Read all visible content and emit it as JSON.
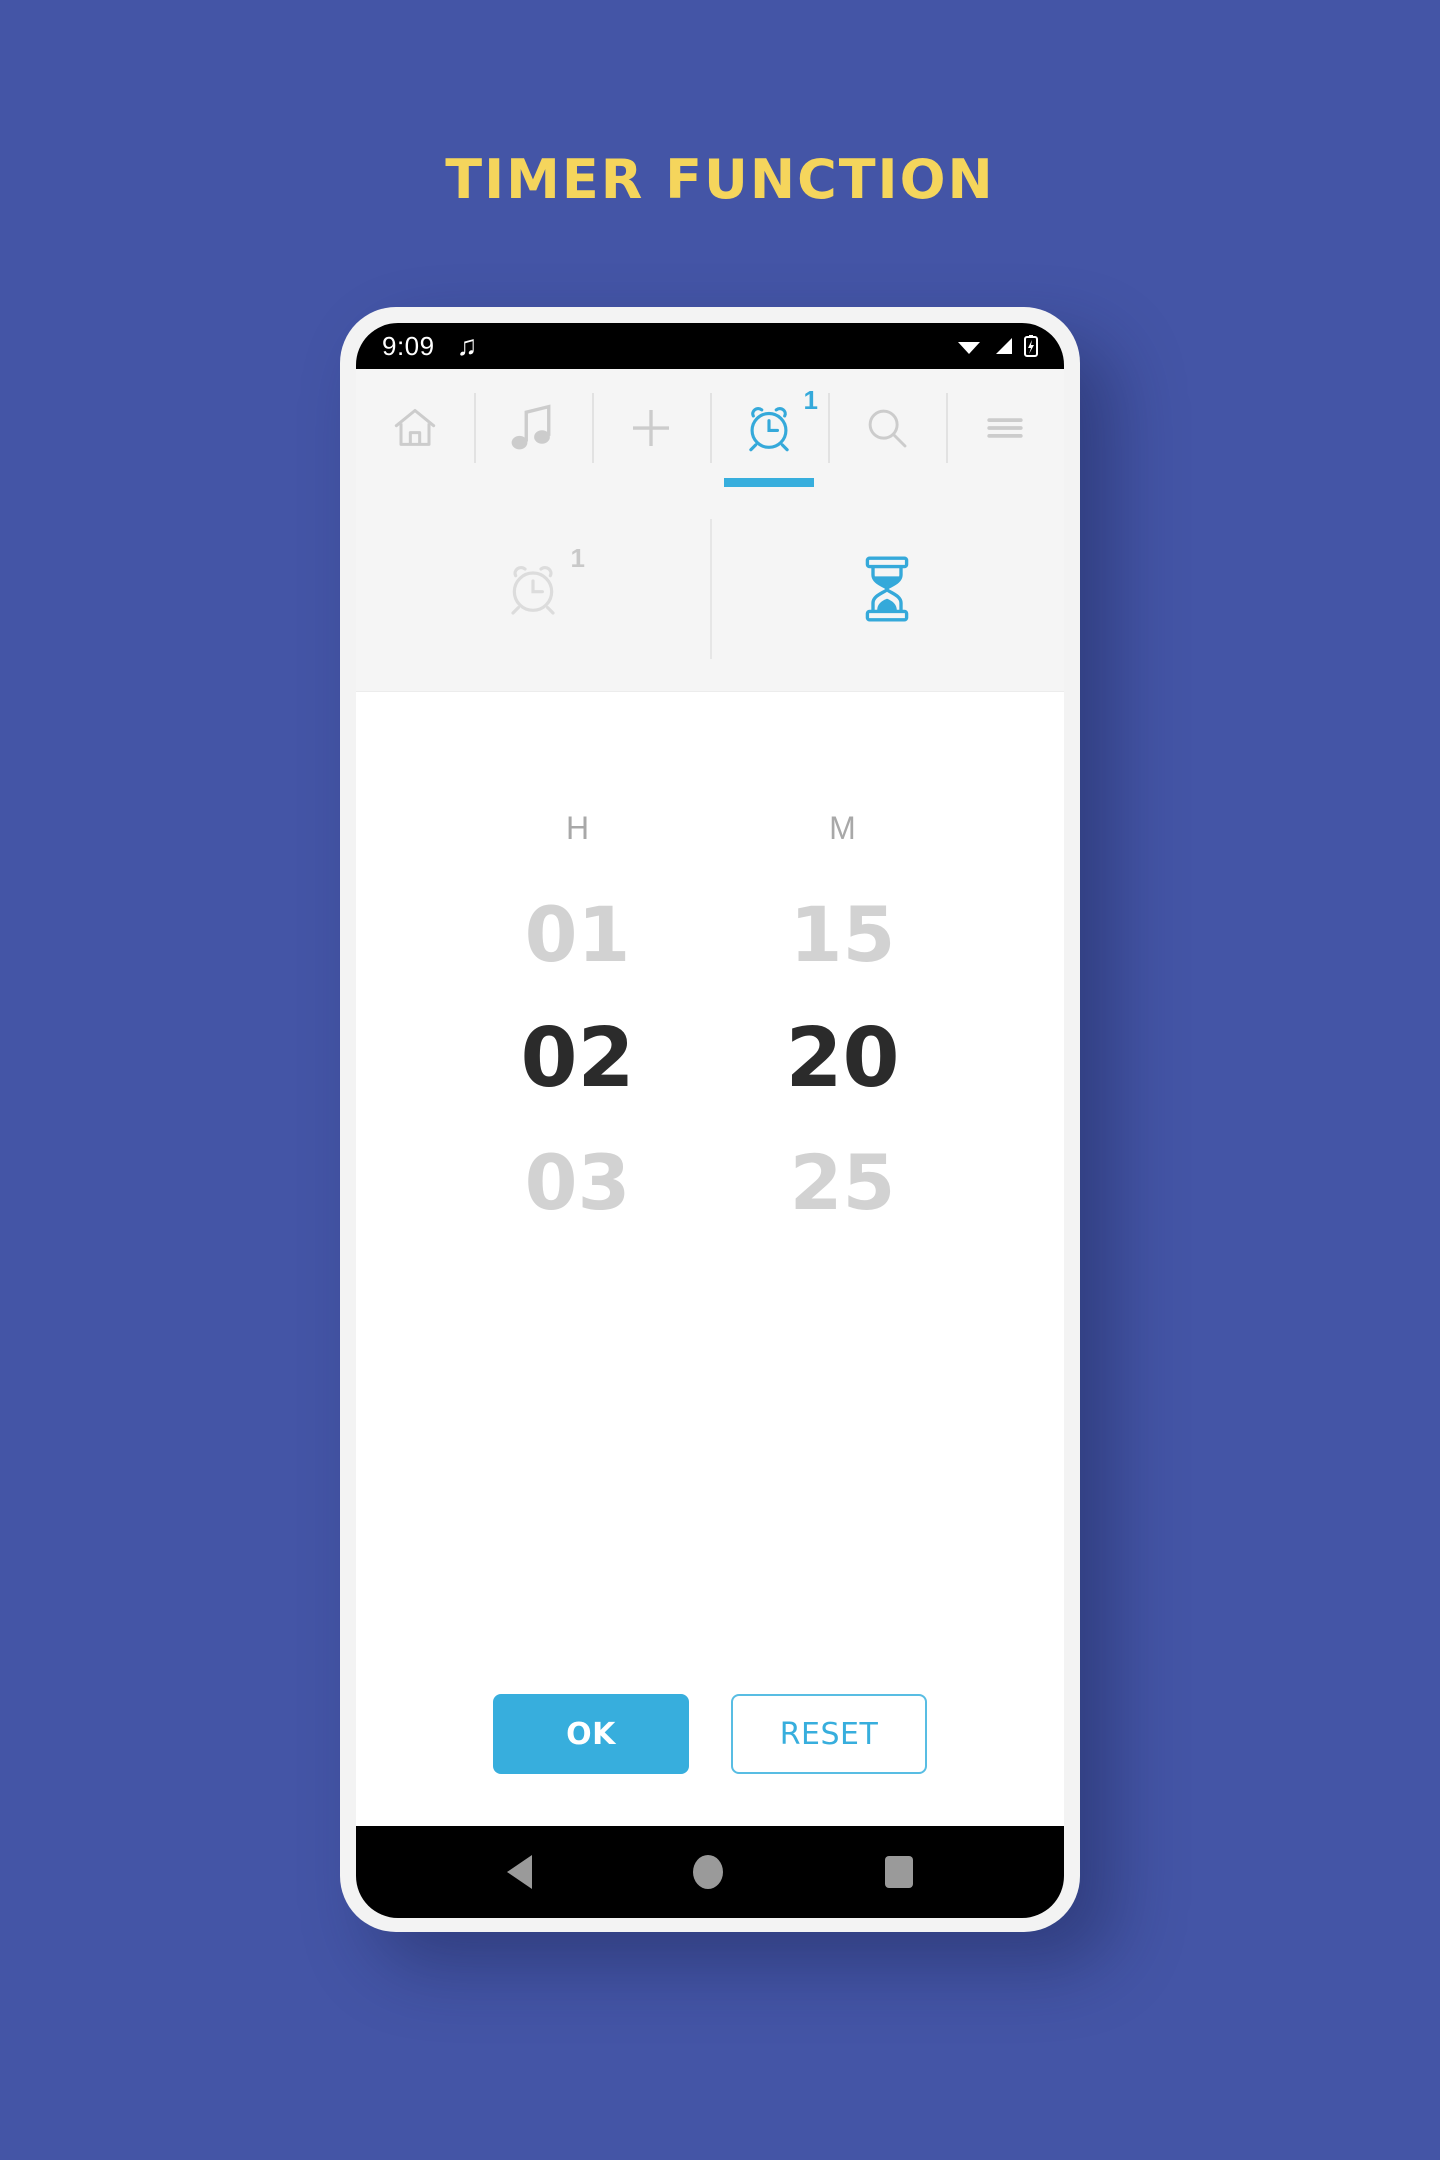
{
  "poster": {
    "title": "TIMER FUNCTION",
    "background_color": "#4455a6",
    "title_color": "#f5d55c"
  },
  "status_bar": {
    "time": "9:09",
    "music_icon": "music-note-icon",
    "wifi_icon": "wifi-icon",
    "signal_icon": "signal-icon",
    "battery_icon": "battery-icon"
  },
  "top_nav": {
    "items": [
      {
        "icon": "home-icon",
        "active": false,
        "badge": ""
      },
      {
        "icon": "music-note-icon",
        "active": false,
        "badge": ""
      },
      {
        "icon": "plus-icon",
        "active": false,
        "badge": ""
      },
      {
        "icon": "alarm-clock-icon",
        "active": true,
        "badge": "1"
      },
      {
        "icon": "search-icon",
        "active": false,
        "badge": ""
      },
      {
        "icon": "hamburger-menu-icon",
        "active": false,
        "badge": ""
      }
    ],
    "active_indicator_color": "#37aedd"
  },
  "sub_tabs": [
    {
      "icon": "alarm-clock-icon",
      "badge": "1",
      "active": false
    },
    {
      "icon": "hourglass-icon",
      "badge": "",
      "active": true
    }
  ],
  "picker": {
    "columns": [
      {
        "label": "H",
        "values": [
          "01",
          "02",
          "03"
        ],
        "selected_index": 1
      },
      {
        "label": "M",
        "values": [
          "15",
          "20",
          "25"
        ],
        "selected_index": 1
      }
    ],
    "selected_color": "#2b2b2b",
    "unselected_color": "#d2d2d2"
  },
  "actions": {
    "ok_label": "OK",
    "reset_label": "RESET",
    "primary_color": "#37aedd"
  },
  "android_nav": {
    "back": "back-triangle-icon",
    "home": "home-circle-icon",
    "recents": "recents-square-icon"
  }
}
